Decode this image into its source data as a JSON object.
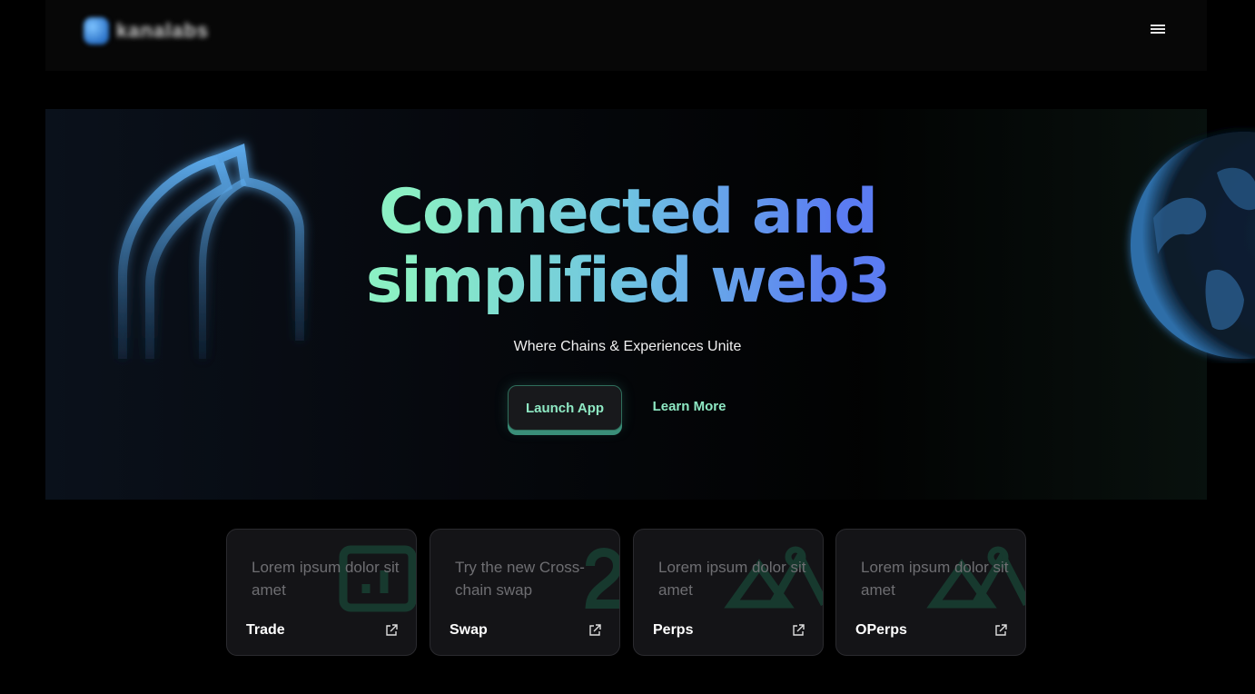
{
  "header": {
    "logo_text": "kanalabs",
    "menu_icon": "hamburger-menu-icon"
  },
  "hero": {
    "headline_line1": "Connected and",
    "headline_line2": "simplified web3",
    "subtitle": "Where Chains & Experiences Unite",
    "primary_button": "Launch App",
    "secondary_link": "Learn More",
    "accent_color": "#8ee8c3",
    "gradient_end_color": "#5b7cf2"
  },
  "cards": [
    {
      "description": "Lorem ipsum dolor sit amet",
      "title": "Trade",
      "icon": "external-link-icon"
    },
    {
      "description": "Try the new Cross-chain swap",
      "title": "Swap",
      "icon": "external-link-icon"
    },
    {
      "description": "Lorem ipsum dolor sit amet",
      "title": "Perps",
      "icon": "external-link-icon"
    },
    {
      "description": "Lorem ipsum dolor sit amet",
      "title": "OPerps",
      "icon": "external-link-icon"
    }
  ]
}
